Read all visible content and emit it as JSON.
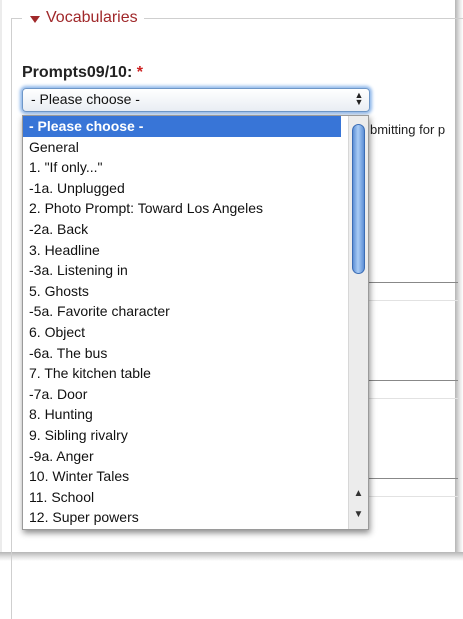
{
  "fieldset": {
    "legend": "Vocabularies"
  },
  "field": {
    "label": "Prompts09/10:",
    "required_mark": "*"
  },
  "select": {
    "value": "- Please choose -",
    "arrows_icon": "up-down-arrows-icon"
  },
  "background": {
    "partial_text": "bmitting for p"
  },
  "dropdown": {
    "selected_index": 0,
    "options": [
      "- Please choose -",
      "General",
      "1. \"If only...\"",
      "-1a. Unplugged",
      "2. Photo Prompt: Toward Los Angeles",
      "-2a. Back",
      "3. Headline",
      "-3a. Listening in",
      "5. Ghosts",
      "-5a. Favorite character",
      "6. Object",
      "-6a. The bus",
      "7. The kitchen table",
      "-7a. Door",
      "8. Hunting",
      "9. Sibling rivalry",
      "-9a. Anger",
      "10. Winter Tales",
      "11. School",
      "12. Super powers"
    ]
  },
  "colors": {
    "legend": "#a0282a",
    "required": "#cc1f1f",
    "selection": "#3875d7",
    "focus_ring": "#8eb7ea"
  }
}
